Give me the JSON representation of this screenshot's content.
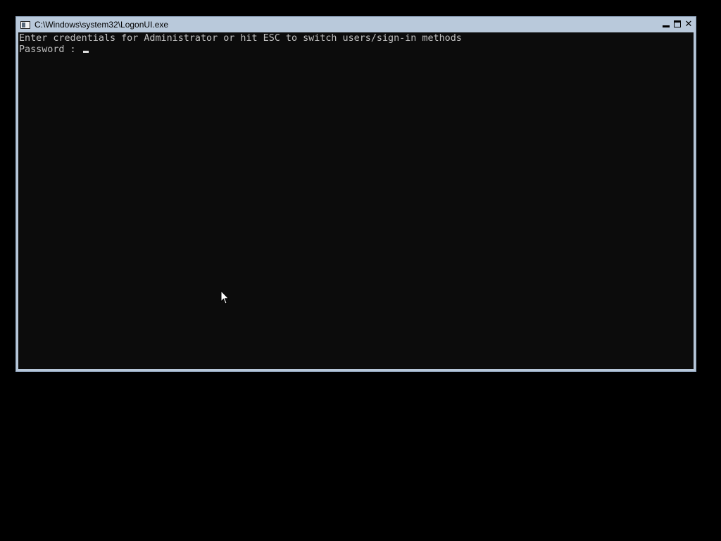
{
  "window": {
    "title": "C:\\Windows\\system32\\LogonUI.exe",
    "close_glyph": "✕"
  },
  "console": {
    "prompt_line": "Enter credentials for Administrator or hit ESC to switch users/sign-in methods",
    "password_label": "Password : "
  },
  "icons": {
    "app": "console-window-icon",
    "minimize": "minimize-icon",
    "maximize": "maximize-icon",
    "close": "close-icon",
    "cursor": "mouse-pointer-icon"
  },
  "colors": {
    "background": "#000000",
    "console_bg": "#0c0c0c",
    "console_text": "#c0c0c0",
    "titlebar": "#b9c9db"
  }
}
